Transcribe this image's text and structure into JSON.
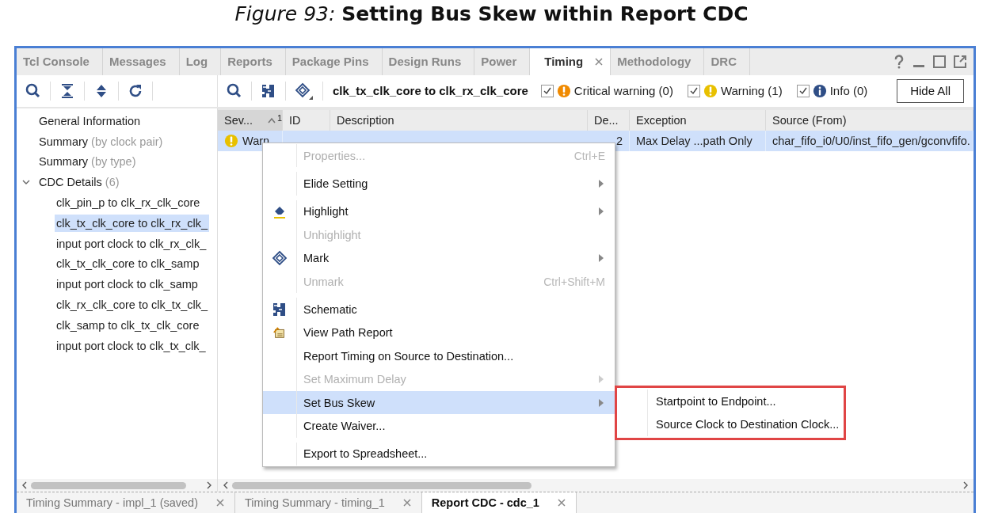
{
  "caption": "*Figure 93:* **Setting Bus Skew within Report CDC**",
  "tabs": [
    {
      "label": "Tcl Console",
      "selected": false,
      "closable": false
    },
    {
      "label": "Messages",
      "selected": false,
      "closable": false
    },
    {
      "label": "Log",
      "selected": false,
      "closable": false
    },
    {
      "label": "Reports",
      "selected": false,
      "closable": false
    },
    {
      "label": "Package Pins",
      "selected": false,
      "closable": false
    },
    {
      "label": "Design Runs",
      "selected": false,
      "closable": false
    },
    {
      "label": "Power",
      "selected": false,
      "closable": false
    },
    {
      "label": "Timing",
      "selected": true,
      "closable": true
    },
    {
      "label": "Methodology",
      "selected": false,
      "closable": false
    },
    {
      "label": "DRC",
      "selected": false,
      "closable": false
    }
  ],
  "toolbar": {
    "title": "clk_tx_clk_core to clk_rx_clk_core",
    "button": "Hide All"
  },
  "filters": [
    {
      "kind": "critical",
      "label": "Critical warning (0)",
      "checked": true
    },
    {
      "kind": "warning",
      "label": "Warning (1)",
      "checked": true
    },
    {
      "kind": "info",
      "label": "Info (0)",
      "checked": true
    }
  ],
  "tree": [
    {
      "label": "General Information",
      "selected": false
    },
    {
      "label": "Summary",
      "note": "(by clock pair)",
      "selected": false
    },
    {
      "label": "Summary",
      "note": "(by type)",
      "selected": false
    },
    {
      "label": "CDC Details",
      "note": "(6)",
      "selected": false,
      "expanded": true,
      "children": [
        {
          "label": "clk_pin_p to clk_rx_clk_core",
          "selected": false
        },
        {
          "label": "clk_tx_clk_core to clk_rx_clk_",
          "selected": true
        },
        {
          "label": "input port clock to clk_rx_clk_",
          "selected": false
        },
        {
          "label": "clk_tx_clk_core to clk_samp",
          "selected": false
        },
        {
          "label": "input port clock to clk_samp",
          "selected": false
        },
        {
          "label": "clk_rx_clk_core to clk_tx_clk_",
          "selected": false
        },
        {
          "label": "clk_samp to clk_tx_clk_core",
          "selected": false
        },
        {
          "label": "input port clock to clk_tx_clk_",
          "selected": false
        }
      ]
    }
  ],
  "table": {
    "columns": [
      {
        "label": "Sev...",
        "sort": "1"
      },
      {
        "label": "ID"
      },
      {
        "label": "Description"
      },
      {
        "label": "De..."
      },
      {
        "label": "Exception"
      },
      {
        "label": "Source (From)"
      }
    ],
    "rows": [
      {
        "selected": true,
        "severity": "Warn",
        "de": "2",
        "exception": "Max Delay ...path Only",
        "source": "char_fifo_i0/U0/inst_fifo_gen/gconvfifo."
      }
    ]
  },
  "context_menu": [
    {
      "label": "Properties...",
      "shortcut": "Ctrl+E",
      "disabled": true,
      "submenu": false,
      "selected": false,
      "kind": "plain",
      "separator_after": true
    },
    {
      "label": "Elide Setting",
      "disabled": false,
      "submenu": true,
      "selected": false,
      "kind": "plain",
      "separator_after": true
    },
    {
      "label": "Highlight",
      "disabled": false,
      "submenu": true,
      "selected": false,
      "kind": "highlight",
      "separator_after": false
    },
    {
      "label": "Unhighlight",
      "disabled": true,
      "submenu": false,
      "selected": false,
      "kind": "plain",
      "separator_after": false
    },
    {
      "label": "Mark",
      "disabled": false,
      "submenu": true,
      "selected": false,
      "kind": "mark",
      "separator_after": false
    },
    {
      "label": "Unmark",
      "shortcut": "Ctrl+Shift+M",
      "disabled": true,
      "submenu": false,
      "selected": false,
      "kind": "plain",
      "separator_after": true
    },
    {
      "label": "Schematic",
      "disabled": false,
      "submenu": false,
      "selected": false,
      "kind": "schematic",
      "separator_after": false
    },
    {
      "label": "View Path Report",
      "disabled": false,
      "submenu": false,
      "selected": false,
      "kind": "report",
      "separator_after": false
    },
    {
      "label": "Report Timing on Source to Destination...",
      "disabled": false,
      "submenu": false,
      "selected": false,
      "kind": "plain",
      "separator_after": false
    },
    {
      "label": "Set Maximum Delay",
      "disabled": true,
      "submenu": true,
      "selected": false,
      "kind": "plain",
      "separator_after": false
    },
    {
      "label": "Set Bus Skew",
      "disabled": false,
      "submenu": true,
      "selected": true,
      "kind": "plain",
      "separator_after": false
    },
    {
      "label": "Create Waiver...",
      "disabled": false,
      "submenu": false,
      "selected": false,
      "kind": "plain",
      "separator_after": true
    },
    {
      "label": "Export to Spreadsheet...",
      "disabled": false,
      "submenu": false,
      "selected": false,
      "kind": "plain",
      "separator_after": false
    }
  ],
  "submenu": [
    "Startpoint to Endpoint...",
    "Source Clock to Destination Clock..."
  ],
  "bottom_tabs": [
    {
      "label": "Timing Summary - impl_1 (saved)",
      "selected": false
    },
    {
      "label": "Timing Summary - timing_1",
      "selected": false
    },
    {
      "label": "Report CDC - cdc_1",
      "selected": true
    }
  ]
}
